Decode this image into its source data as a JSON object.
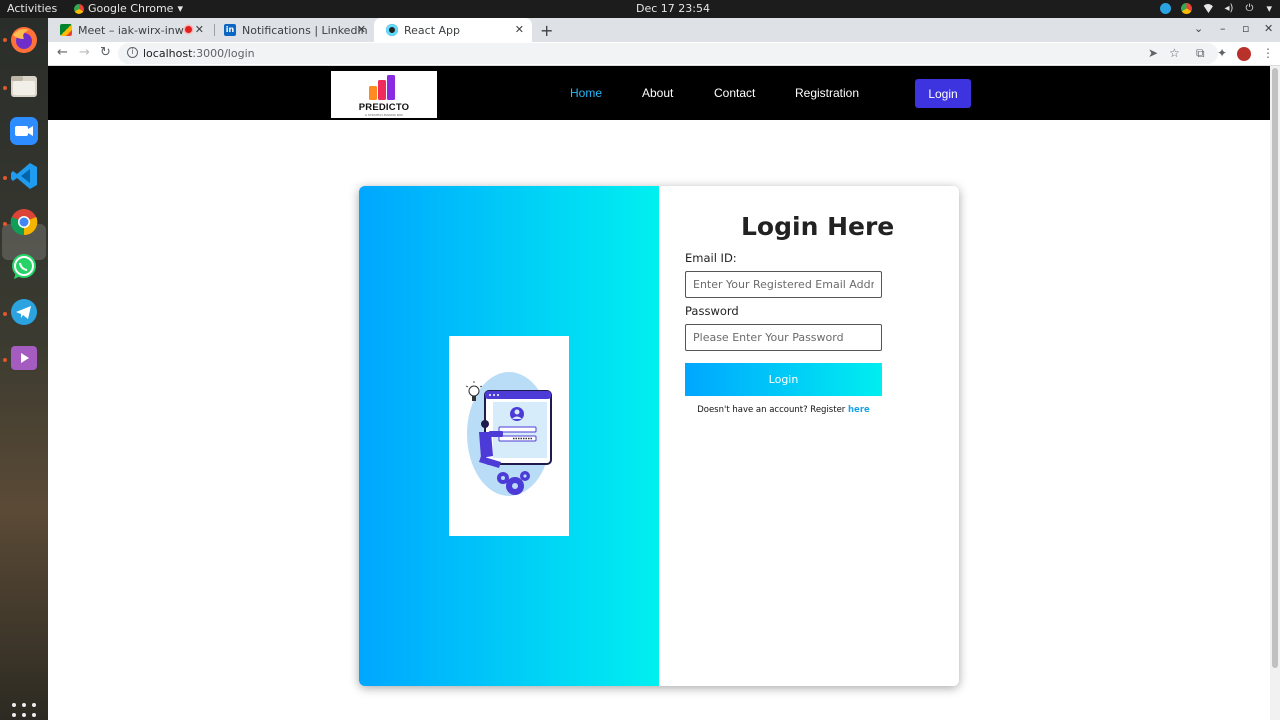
{
  "system": {
    "activities": "Activities",
    "app_name": "Google Chrome",
    "clock": "Dec 17  23:54"
  },
  "browser": {
    "tabs": [
      {
        "title": "Meet – iak-wirx-inw",
        "favicon_color": "#34a853",
        "recording": true
      },
      {
        "title": "Notifications | LinkedIn",
        "favicon_color": "#0a66c2"
      },
      {
        "title": "React App",
        "favicon_color": "#222222",
        "active": true
      }
    ],
    "url_host": "localhost",
    "url_path": ":3000/login"
  },
  "navbar": {
    "logo_text": "PREDICTO",
    "logo_tagline": "A STRATEGY-MAKING BOX",
    "links": {
      "home": "Home",
      "about": "About",
      "contact": "Contact",
      "registration": "Registration"
    },
    "login_button": "Login",
    "active_color": "#29b6f6",
    "button_color": "#3d34e0"
  },
  "login": {
    "title": "Login Here",
    "email_label": "Email ID:",
    "email_placeholder": "Enter Your Registered Email Address",
    "password_label": "Password",
    "password_placeholder": "Please Enter Your Password",
    "submit_label": "Login",
    "register_prompt": "Doesn't have an account? Register ",
    "register_link": "here",
    "gradient_start": "#00a6ff",
    "gradient_end": "#00f0f0"
  }
}
